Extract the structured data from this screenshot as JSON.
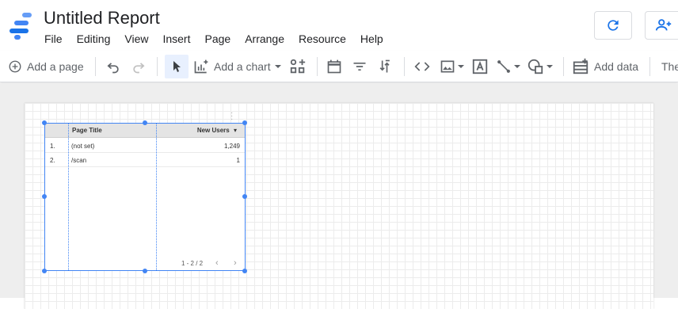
{
  "app": {
    "title": "Untitled Report",
    "brand_colors": [
      "#4285f4",
      "#669df6",
      "#1a73e8"
    ]
  },
  "menu": [
    "File",
    "Editing",
    "View",
    "Insert",
    "Page",
    "Arrange",
    "Resource",
    "Help"
  ],
  "header_buttons": {
    "refresh_icon": "refresh-icon",
    "share_icon": "person-add-icon"
  },
  "toolbar": {
    "add_page_label": "Add a page",
    "add_chart_label": "Add a chart",
    "add_data_label": "Add data",
    "theme_label": "The"
  },
  "table": {
    "columns": [
      "Page Title",
      "New Users"
    ],
    "sort_indicator": "▾",
    "rows": [
      {
        "index": "1.",
        "page_title": "(not set)",
        "new_users": "1,249"
      },
      {
        "index": "2.",
        "page_title": "/scan",
        "new_users": "1"
      }
    ],
    "pagination": "1 - 2 / 2",
    "prev": "‹",
    "next": "›"
  }
}
